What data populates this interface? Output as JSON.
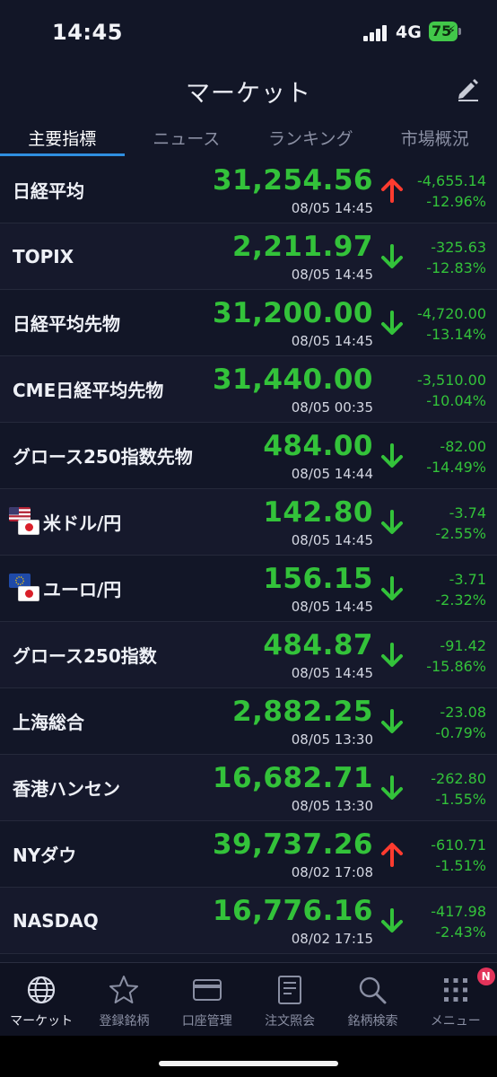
{
  "status_bar": {
    "time": "14:45",
    "network": "4G",
    "battery": "75"
  },
  "header": {
    "title": "マーケット",
    "edit_icon": "pencil-icon"
  },
  "tabs": [
    {
      "label": "主要指標",
      "active": true
    },
    {
      "label": "ニュース",
      "active": false
    },
    {
      "label": "ランキング",
      "active": false
    },
    {
      "label": "市場概況",
      "active": false
    }
  ],
  "colors": {
    "up_arrow": "#ff3b2f",
    "down_arrow": "#33c23a",
    "value": "#33c23a",
    "accent": "#2f8fe0"
  },
  "markets": [
    {
      "name": "日経平均",
      "price": "31,254.56",
      "time": "08/05 14:45",
      "change": "-4,655.14",
      "percent": "-12.96%",
      "arrow": "up"
    },
    {
      "name": "TOPIX",
      "price": "2,211.97",
      "time": "08/05 14:45",
      "change": "-325.63",
      "percent": "-12.83%",
      "arrow": "down"
    },
    {
      "name": "日経平均先物",
      "price": "31,200.00",
      "time": "08/05 14:45",
      "change": "-4,720.00",
      "percent": "-13.14%",
      "arrow": "down"
    },
    {
      "name": "CME日経平均先物",
      "price": "31,440.00",
      "time": "08/05 00:35",
      "change": "-3,510.00",
      "percent": "-10.04%",
      "arrow": "none"
    },
    {
      "name": "グロース250指数先物",
      "price": "484.00",
      "time": "08/05 14:44",
      "change": "-82.00",
      "percent": "-14.49%",
      "arrow": "down"
    },
    {
      "name": "米ドル/円",
      "price": "142.80",
      "time": "08/05 14:45",
      "change": "-3.74",
      "percent": "-2.55%",
      "arrow": "down",
      "flag": "us-jp-flag-icon"
    },
    {
      "name": "ユーロ/円",
      "price": "156.15",
      "time": "08/05 14:45",
      "change": "-3.71",
      "percent": "-2.32%",
      "arrow": "down",
      "flag": "eu-jp-flag-icon"
    },
    {
      "name": "グロース250指数",
      "price": "484.87",
      "time": "08/05 14:45",
      "change": "-91.42",
      "percent": "-15.86%",
      "arrow": "down"
    },
    {
      "name": "上海総合",
      "price": "2,882.25",
      "time": "08/05 13:30",
      "change": "-23.08",
      "percent": "-0.79%",
      "arrow": "down"
    },
    {
      "name": "香港ハンセン",
      "price": "16,682.71",
      "time": "08/05 13:30",
      "change": "-262.80",
      "percent": "-1.55%",
      "arrow": "down"
    },
    {
      "name": "NYダウ",
      "price": "39,737.26",
      "time": "08/02 17:08",
      "change": "-610.71",
      "percent": "-1.51%",
      "arrow": "up"
    },
    {
      "name": "NASDAQ",
      "price": "16,776.16",
      "time": "08/02 17:15",
      "change": "-417.98",
      "percent": "-2.43%",
      "arrow": "down"
    }
  ],
  "bottom_nav": [
    {
      "label": "マーケット",
      "icon": "globe-icon",
      "active": true
    },
    {
      "label": "登録銘柄",
      "icon": "star-icon",
      "active": false
    },
    {
      "label": "口座管理",
      "icon": "card-icon",
      "active": false
    },
    {
      "label": "注文照会",
      "icon": "document-icon",
      "active": false
    },
    {
      "label": "銘柄検索",
      "icon": "search-icon",
      "active": false
    },
    {
      "label": "メニュー",
      "icon": "grid-menu-icon",
      "active": false,
      "badge": "N"
    }
  ]
}
